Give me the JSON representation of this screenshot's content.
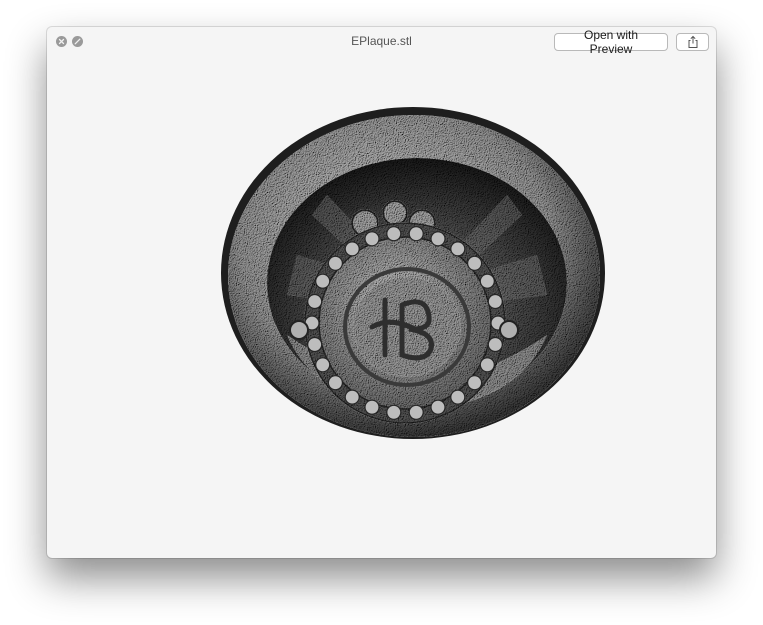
{
  "window": {
    "title": "EPlaque.stl"
  },
  "toolbar": {
    "open_with_label": "Open with Preview",
    "share_icon": "share-icon"
  },
  "controls": {
    "close_icon": "close-icon",
    "fullscreen_icon": "fullscreen-icon"
  },
  "preview": {
    "model_icon": "stl-plaque-model"
  },
  "colors": {
    "window_background": "#f5f5f5",
    "traffic_light": "#9a9a9a"
  }
}
